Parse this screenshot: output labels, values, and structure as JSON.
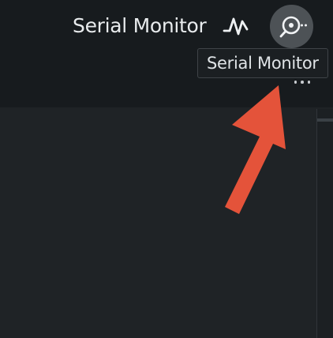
{
  "toolbar": {
    "label": "Serial Monitor",
    "plotter_icon": "pulse-icon",
    "monitor_icon": "magnifier-icon",
    "more_icon": "ellipsis-icon"
  },
  "tooltip": {
    "text": "Serial Monitor"
  },
  "colors": {
    "toolbar_bg": "#171b1e",
    "content_bg": "#1f2326",
    "button_hover_bg": "#4d5256",
    "arrow": "#e4533a"
  }
}
